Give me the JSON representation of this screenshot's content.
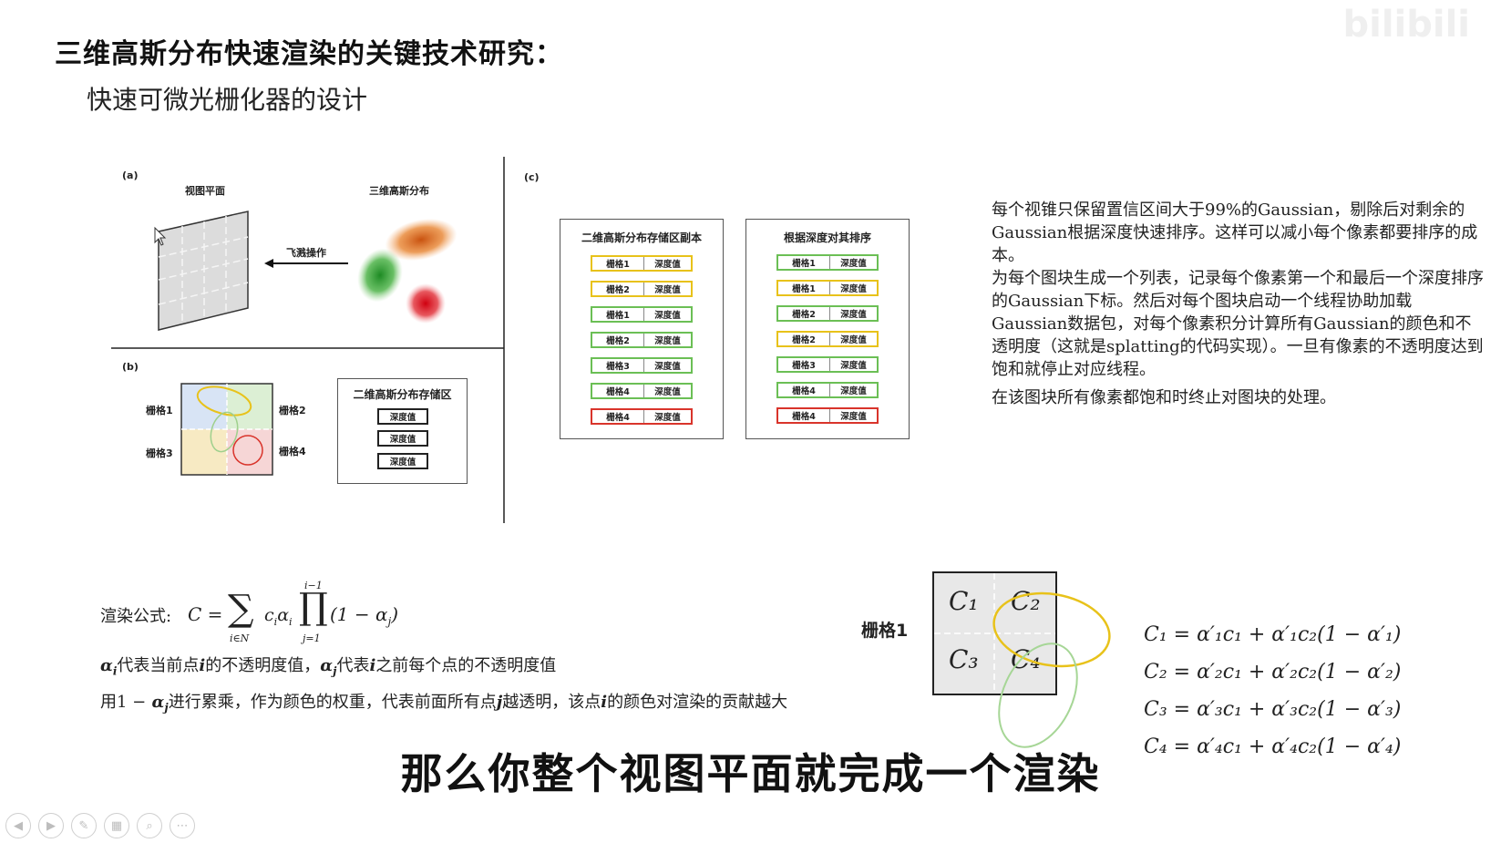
{
  "slide": {
    "title": "三维高斯分布快速渲染的关键技术研究：",
    "subtitle": "快速可微光栅化器的设计"
  },
  "figure": {
    "panel_a": {
      "label": "(a)",
      "view_plane": "视图平面",
      "gaussian_3d": "三维高斯分布",
      "splat_op": "飞溅操作"
    },
    "panel_b": {
      "label": "(b)",
      "grid1": "栅格1",
      "grid2": "栅格2",
      "grid3": "栅格3",
      "grid4": "栅格4",
      "storage_title": "二维高斯分布存储区",
      "storage_cells": [
        "深度值",
        "深度值",
        "深度值"
      ]
    },
    "panel_c": {
      "label": "(c)",
      "copy_title": "二维高斯分布存储区副本",
      "copy_rows": [
        {
          "grid": "栅格1",
          "depth": "深度值",
          "color": "yellow"
        },
        {
          "grid": "栅格2",
          "depth": "深度值",
          "color": "yellow"
        },
        {
          "grid": "栅格1",
          "depth": "深度值",
          "color": "green"
        },
        {
          "grid": "栅格2",
          "depth": "深度值",
          "color": "green"
        },
        {
          "grid": "栅格3",
          "depth": "深度值",
          "color": "green"
        },
        {
          "grid": "栅格4",
          "depth": "深度值",
          "color": "green"
        },
        {
          "grid": "栅格4",
          "depth": "深度值",
          "color": "red"
        }
      ],
      "sort_title": "根据深度对其排序",
      "sort_rows": [
        {
          "grid": "栅格1",
          "depth": "深度值",
          "color": "green"
        },
        {
          "grid": "栅格1",
          "depth": "深度值",
          "color": "yellow"
        },
        {
          "grid": "栅格2",
          "depth": "深度值",
          "color": "green"
        },
        {
          "grid": "栅格2",
          "depth": "深度值",
          "color": "yellow"
        },
        {
          "grid": "栅格3",
          "depth": "深度值",
          "color": "green"
        },
        {
          "grid": "栅格4",
          "depth": "深度值",
          "color": "green"
        },
        {
          "grid": "栅格4",
          "depth": "深度值",
          "color": "red"
        }
      ]
    }
  },
  "description": {
    "para1": "每个视锥只保留置信区间大于99%的Gaussian，剔除后对剩余的Gaussian根据深度快速排序。这样可以减小每个像素都要排序的成本。",
    "para2": "为每个图块生成一个列表，记录每个像素第一个和最后一个深度排序的Gaussian下标。然后对每个图块启动一个线程协助加载Gaussian数据包，对每个像素积分计算所有Gaussian的颜色和不透明度（这就是splatting的代码实现）。一旦有像素的不透明度达到饱和就停止对应线程。",
    "para3": "在该图块所有像素都饱和时终止对图块的处理。"
  },
  "formula": {
    "label": "渲染公式:",
    "expr_lhs": "C =",
    "sum_top": "",
    "sum_bottom": "i∈N",
    "sum_body": "c",
    "prod_top": "i−1",
    "prod_bottom": "j=1",
    "prod_body": "(1 − α",
    "line2_a": "代表当前点",
    "line2_b": "的不透明度值，",
    "line2_c": "代表",
    "line2_d": "之前每个点的不透明度值",
    "line3_a": "用1 −",
    "line3_b": "进行累乘，作为颜色的权重，代表前面所有点",
    "line3_c": "越透明，该点",
    "line3_d": "的颜色对渲染的贡献越大"
  },
  "grid_diagram": {
    "label": "栅格1",
    "cells": [
      "C₁",
      "C₂",
      "C₃",
      "C₄"
    ]
  },
  "equations": [
    "C₁ = α′₁c₁ + α′₁c₂(1 − α′₁)",
    "C₂ = α′₂c₁ + α′₂c₂(1 − α′₂)",
    "C₃ = α′₃c₁ + α′₃c₂(1 − α′₃)",
    "C₄ = α′₄c₁ + α′₄c₂(1 − α′₄)"
  ],
  "caption": "那么你整个视图平面就完成一个渲染",
  "watermark": "bilibili",
  "colors": {
    "yellow": "#e8c21a",
    "green": "#6bbf55",
    "red": "#d9342b",
    "orange_gaussian": "#e07a1f"
  },
  "toolbar": {
    "icons": [
      "prev-icon",
      "next-icon",
      "pen-icon",
      "slides-icon",
      "zoom-icon",
      "more-icon"
    ]
  }
}
